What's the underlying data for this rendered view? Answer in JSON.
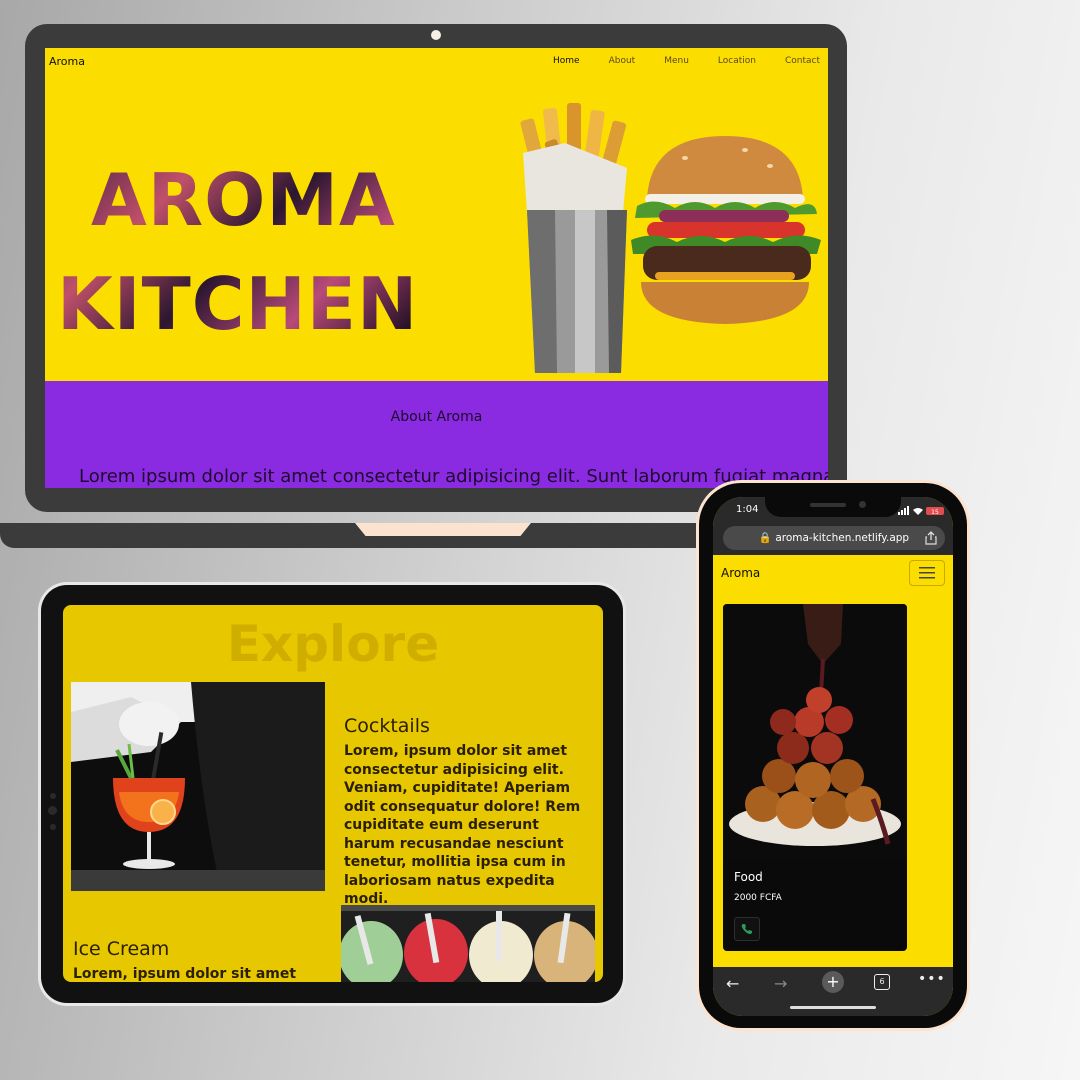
{
  "laptop": {
    "brand": "Aroma",
    "nav": [
      "Home",
      "About",
      "Menu",
      "Location",
      "Contact"
    ],
    "hero_line1": "AROMA",
    "hero_line2": "KITCHEN",
    "about_title": "About Aroma",
    "about_text": "Lorem ipsum dolor sit amet consectetur adipisicing elit. Sunt laborum fugiat magnam",
    "colors": {
      "hero_bg": "#fbdd00",
      "about_bg": "#8a2be2"
    }
  },
  "tablet": {
    "section_title": "Explore",
    "cocktails_title": "Cocktails",
    "cocktails_text": "Lorem, ipsum dolor sit amet consectetur adipisicing elit. Veniam, cupiditate! Aperiam odit consequatur dolore! Rem cupiditate eum deserunt harum recusandae nesciunt tenetur, mollitia ipsa cum in laboriosam natus expedita modi.",
    "icecream_title": "Ice Cream",
    "icecream_text": "Lorem, ipsum dolor sit amet"
  },
  "phone": {
    "time": "1:04",
    "battery": "15",
    "url": "aroma-kitchen.netlify.app",
    "brand": "Aroma",
    "card_title": "Food",
    "card_price": "2000 FCFA",
    "tab_count": "6",
    "icons": [
      "lock-icon",
      "share-icon",
      "hamburger-icon",
      "phone-icon",
      "back-icon",
      "forward-icon",
      "new-tab-icon",
      "tabs-icon",
      "more-icon"
    ]
  }
}
